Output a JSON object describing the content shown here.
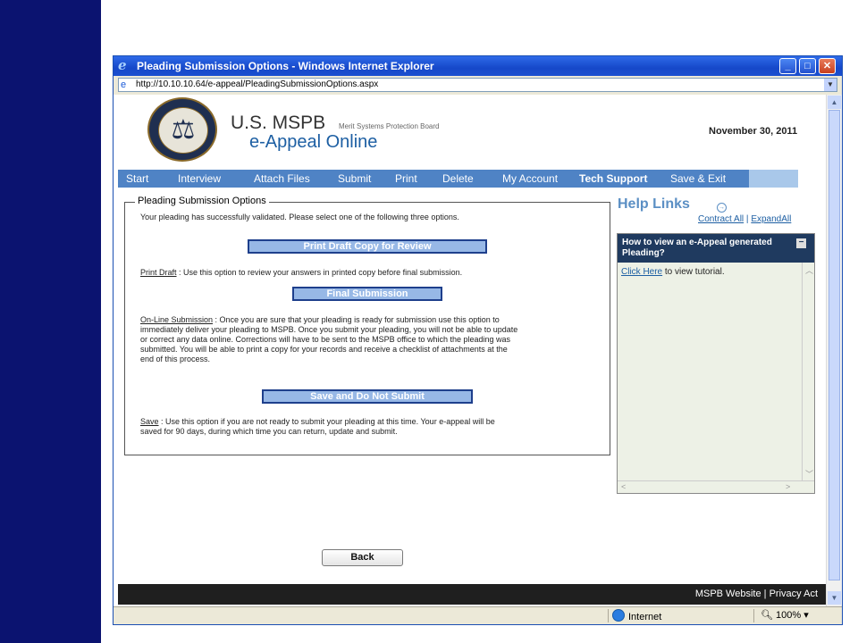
{
  "window": {
    "title": "Pleading Submission Options - Windows Internet Explorer"
  },
  "address": {
    "url": "http://10.10.10.64/e-appeal/PleadingSubmissionOptions.aspx"
  },
  "header": {
    "brand_main": "U.S. MSPB",
    "brand_sub": "Merit Systems Protection Board",
    "brand_product": "e-Appeal Online",
    "date": "November 30, 2011"
  },
  "nav": {
    "items": [
      "Start",
      "Interview",
      "Attach Files",
      "Submit",
      "Print",
      "Delete",
      "My Account",
      "Tech Support",
      "Save & Exit"
    ]
  },
  "options": {
    "legend": "Pleading Submission Options",
    "intro": "Your pleading has successfully validated. Please select one of the following three options.",
    "print_draft_button": "Print Draft Copy for Review",
    "print_draft_label": "Print Draft",
    "print_draft_desc": " : Use this option to review your answers in printed copy before final submission.",
    "final_button": "Final Submission",
    "online_label": "On-Line Submission",
    "online_lines": [
      " : Once you are sure that your pleading is ready for submission use this option to",
      "immediately deliver your pleading to MSPB. Once you submit your pleading, you will not be able to update",
      "or correct any data online. Corrections will have to be sent to the MSPB office to which the pleading was",
      "submitted. You will be able to print a copy for your records and receive a checklist of attachments at the",
      "end of this process."
    ],
    "save_button": "Save and Do Not Submit",
    "save_label": "Save",
    "save_lines": [
      " : Use this option if you are not ready to submit your pleading at this time. Your e-appeal will be",
      "saved for 90 days, during which time you can return, update and submit."
    ]
  },
  "help": {
    "title": "Help Links",
    "contract_all": "Contract All",
    "separator": "|",
    "expand_all": "ExpandAll",
    "panel_title": "How to view an e-Appeal generated Pleading?",
    "click_here": "Click Here",
    "tutorial_text": " to view tutorial."
  },
  "back_button": "Back",
  "footer": {
    "website": "MSPB Website",
    "separator": "|",
    "privacy": "Privacy Act"
  },
  "status": {
    "zone": "Internet",
    "zoom": "100%"
  }
}
